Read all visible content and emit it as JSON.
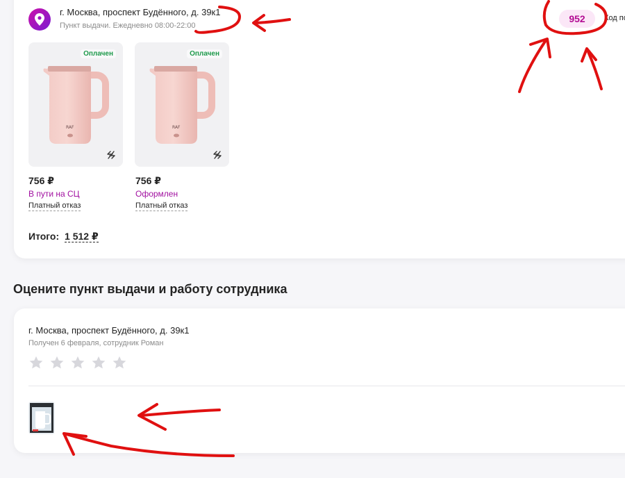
{
  "order": {
    "address": "г. Москва, проспект Будённого, д. 39к1",
    "schedule": "Пункт выдачи. Ежедневно 08:00-22:00",
    "code": "952",
    "code_label": "Код по",
    "items": [
      {
        "badge": "Оплачен",
        "price": "756 ₽",
        "status": "В пути на СЦ",
        "refuse": "Платный отказ"
      },
      {
        "badge": "Оплачен",
        "price": "756 ₽",
        "status": "Оформлен",
        "refuse": "Платный отказ"
      }
    ],
    "total_label": "Итого:",
    "total_value": "1 512 ₽"
  },
  "rating": {
    "title": "Оцените пункт выдачи и работу сотрудника",
    "address": "г. Москва, проспект Будённого, д. 39к1",
    "received": "Получен 6 февраля, сотрудник Роман",
    "stars_max": 5,
    "stars_selected": 0
  },
  "colors": {
    "accent": "#cb11ab",
    "status_purple": "#a10fa0",
    "paid_green": "#1e9a4b",
    "annotation_red": "#e01010"
  },
  "icons": [
    "location-pin-icon",
    "return-icon",
    "star-icon"
  ]
}
